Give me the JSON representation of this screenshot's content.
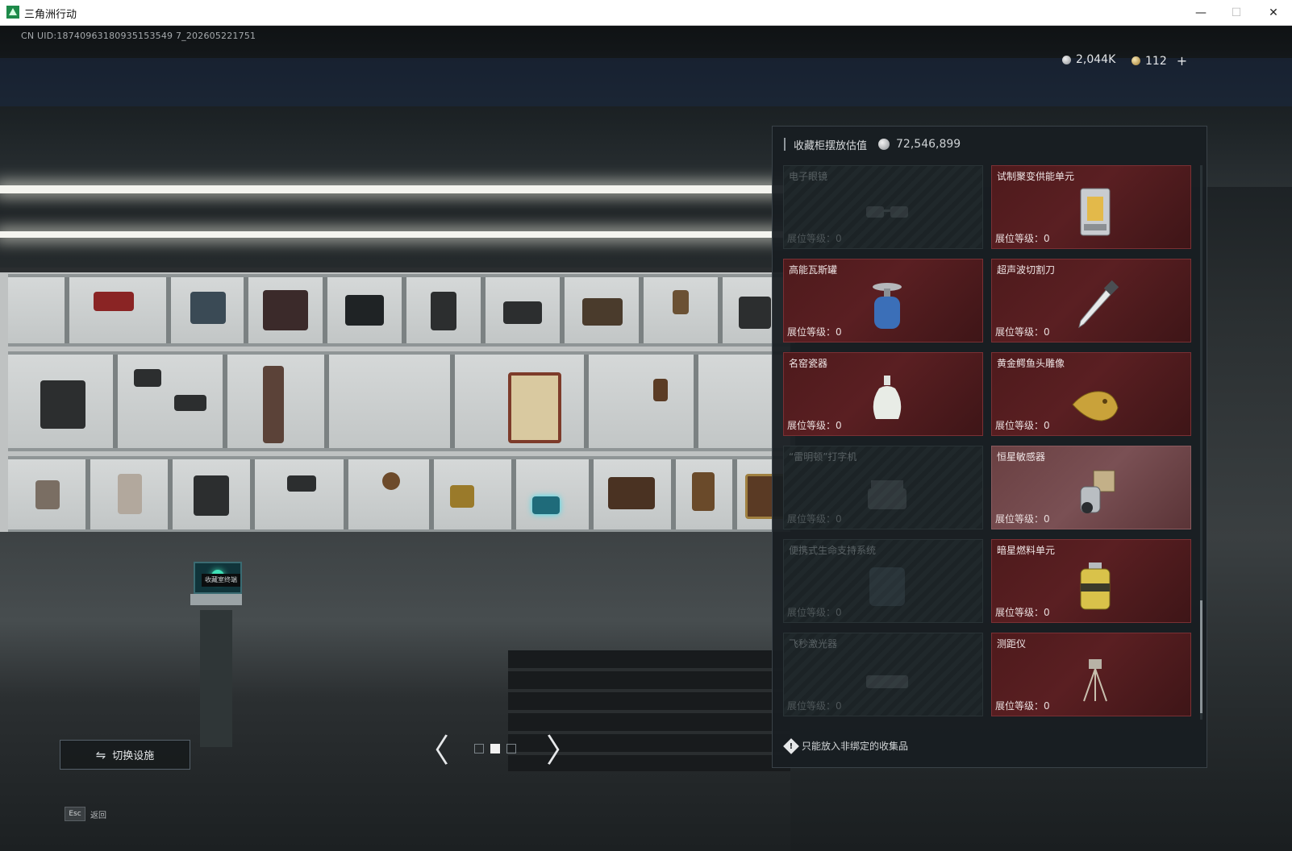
{
  "window": {
    "title": "三角洲行动",
    "min_glyph": "—",
    "max_glyph": "☐",
    "close_glyph": "✕"
  },
  "hud": {
    "uid": "CN UID:18740963180935153549 7_202605221751",
    "currency_silver": "2,044K",
    "currency_gold": "112",
    "currency_add": "+"
  },
  "panel": {
    "title": "收藏柜摆放估值",
    "total_value": "72,546,899",
    "notice": "只能放入非绑定的收集品",
    "level_label": "展位等级：",
    "items": [
      {
        "name": "电子眼镜",
        "level": "0",
        "filled": false
      },
      {
        "name": "试制聚变供能单元",
        "level": "0",
        "filled": true
      },
      {
        "name": "高能瓦斯罐",
        "level": "0",
        "filled": true
      },
      {
        "name": "超声波切割刀",
        "level": "0",
        "filled": true
      },
      {
        "name": "名窑瓷器",
        "level": "0",
        "filled": true
      },
      {
        "name": "黄金鳄鱼头雕像",
        "level": "0",
        "filled": true
      },
      {
        "name": "“雷明顿”打字机",
        "level": "0",
        "filled": false
      },
      {
        "name": "恒星敏感器",
        "level": "0",
        "filled": true
      },
      {
        "name": "便携式生命支持系统",
        "level": "0",
        "filled": false
      },
      {
        "name": "暗星燃料单元",
        "level": "0",
        "filled": true
      },
      {
        "name": "飞秒激光器",
        "level": "0",
        "filled": false
      },
      {
        "name": "测距仪",
        "level": "0",
        "filled": true
      }
    ]
  },
  "controls": {
    "switch_label": "切换设施",
    "prev_glyph": "〈",
    "next_glyph": "〉",
    "esc_key": "Esc",
    "esc_label": "返回"
  },
  "terminal": {
    "label": "收藏室终端"
  },
  "icons": {
    "switch": "swap-icon",
    "warning": "warning-diamond-icon"
  },
  "colors": {
    "card_filled": "#5a1f22",
    "card_empty": "#1c2326",
    "panel_bg": "#181e22"
  }
}
